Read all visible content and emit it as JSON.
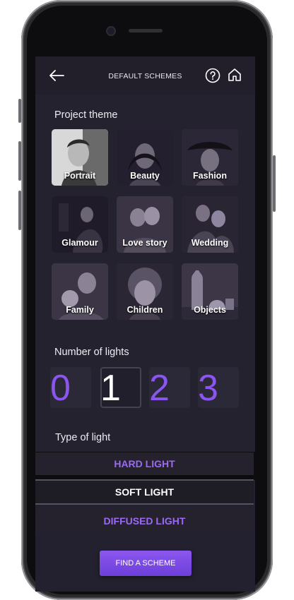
{
  "header": {
    "title": "DEFAULT SCHEMES",
    "back_icon": "arrow-left-icon",
    "help_icon": "question-circle-icon",
    "home_icon": "home-icon"
  },
  "project_theme": {
    "label": "Project theme",
    "selected": "Portrait",
    "tiles": [
      {
        "label": "Portrait"
      },
      {
        "label": "Beauty"
      },
      {
        "label": "Fashion"
      },
      {
        "label": "Glamour"
      },
      {
        "label": "Love story"
      },
      {
        "label": "Wedding"
      },
      {
        "label": "Family"
      },
      {
        "label": "Children"
      },
      {
        "label": "Objects"
      }
    ]
  },
  "number_of_lights": {
    "label": "Number of lights",
    "options": [
      "0",
      "1",
      "2",
      "3"
    ],
    "selected": "1"
  },
  "type_of_light": {
    "label": "Type of light",
    "options": [
      {
        "label": "HARD LIGHT",
        "color": "#9a6af5"
      },
      {
        "label": "SOFT LIGHT",
        "color": "#ffffff"
      },
      {
        "label": "DIFFUSED LIGHT",
        "color": "#9a6af5"
      }
    ],
    "selected": "SOFT LIGHT"
  },
  "find_button": {
    "label": "FIND A SCHEME"
  },
  "colors": {
    "accent": "#8a55f0",
    "background": "#25222f"
  }
}
